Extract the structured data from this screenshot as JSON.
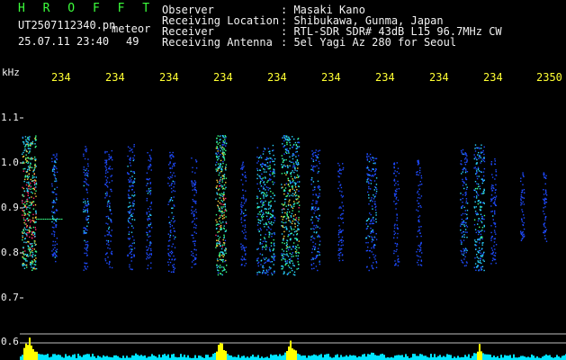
{
  "header": {
    "brand": "H R O F F T",
    "filename": "UT2507112340.pn",
    "mode": "meteor",
    "datetime": "25.07.11 23:40",
    "count": "49"
  },
  "info": {
    "observer_label": "Observer",
    "observer_value": ": Masaki Kano",
    "location_label": "Receiving Location",
    "location_value": ": Shibukawa, Gunma, Japan",
    "receiver_label": "Receiver",
    "receiver_value": ": RTL-SDR SDR# 43dB L15 96.7MHz CW",
    "antenna_label": "Receiving Antenna",
    "antenna_value": ": 5el Yagi Az 280 for Seoul"
  },
  "axis": {
    "unit": "kHz",
    "top_ticks": [
      "234",
      "234",
      "234",
      "234",
      "234",
      "234",
      "234",
      "234",
      "234",
      "2350"
    ],
    "left_ticks": [
      "1.1",
      "1.0",
      "0.9",
      "0.8",
      "0.7",
      "0.6"
    ]
  },
  "colors": {
    "brand": "#3cff3c",
    "tick": "#ffff33",
    "text": "#f2f2f2",
    "background": "#000000",
    "histogram_yellow": "#ffff00",
    "histogram_cyan": "#00e5ff"
  }
}
